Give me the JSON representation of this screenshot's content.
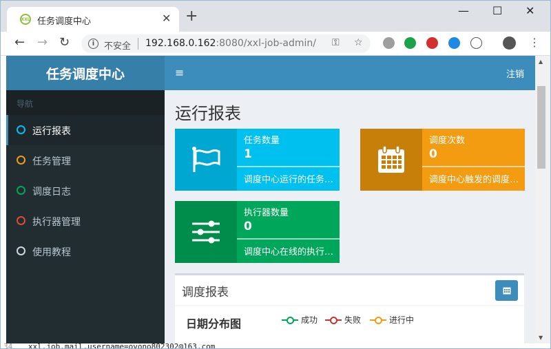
{
  "browser": {
    "tab_title": "任务调度中心",
    "tab_favicon_text": "XXL",
    "new_tab": "+",
    "close_tab": "✕",
    "minimize": "—",
    "maximize": "☐",
    "close_window": "✕",
    "back": "←",
    "forward": "→",
    "reload": "↻",
    "info_glyph": "i",
    "insecure_label": "不安全",
    "url_host": "192.168.0.162",
    "url_rest": ":8080/xxl-job-admin/",
    "key_icon": "⚿",
    "star_icon": "☆",
    "menu_dots": "⋮"
  },
  "app": {
    "logo": "任务调度中心",
    "hamburger": "≡",
    "logout": "注销",
    "sidebar": {
      "header": "导航",
      "items": [
        {
          "label": "运行报表",
          "color": "#00c0ef",
          "active": true
        },
        {
          "label": "任务管理",
          "color": "#f39c12",
          "active": false
        },
        {
          "label": "调度日志",
          "color": "#00a65a",
          "active": false
        },
        {
          "label": "执行器管理",
          "color": "#dd4b39",
          "active": false
        },
        {
          "label": "使用教程",
          "color": "#d2d6de",
          "active": false
        }
      ]
    },
    "content_title": "运行报表",
    "info_boxes": [
      {
        "text": "任务数量",
        "number": "1",
        "desc": "调度中心运行的任务数量",
        "icon": "flag-icon",
        "color": "#00c0ef",
        "icon_bg": "#00a7d0"
      },
      {
        "text": "调度次数",
        "number": "0",
        "desc": "调度中心触发的调度次数",
        "icon": "calendar-icon",
        "color": "#f39c12",
        "icon_bg": "#c87f0a"
      },
      {
        "text": "执行器数量",
        "number": "0",
        "desc": "调度中心在线的执行器机器数量",
        "icon": "sliders-icon",
        "color": "#00a65a",
        "icon_bg": "#008d4c"
      }
    ],
    "report_panel": {
      "title": "调度报表",
      "chart_title": "日期分布图",
      "legend": [
        {
          "label": "成功",
          "color": "#00a65a"
        },
        {
          "label": "失败",
          "color": "#c23531"
        },
        {
          "label": "进行中",
          "color": "#f39c12"
        }
      ]
    }
  },
  "terminal": {
    "line_number": "34",
    "text": "xxl.job.mail.username=ovono802302@163.com"
  }
}
